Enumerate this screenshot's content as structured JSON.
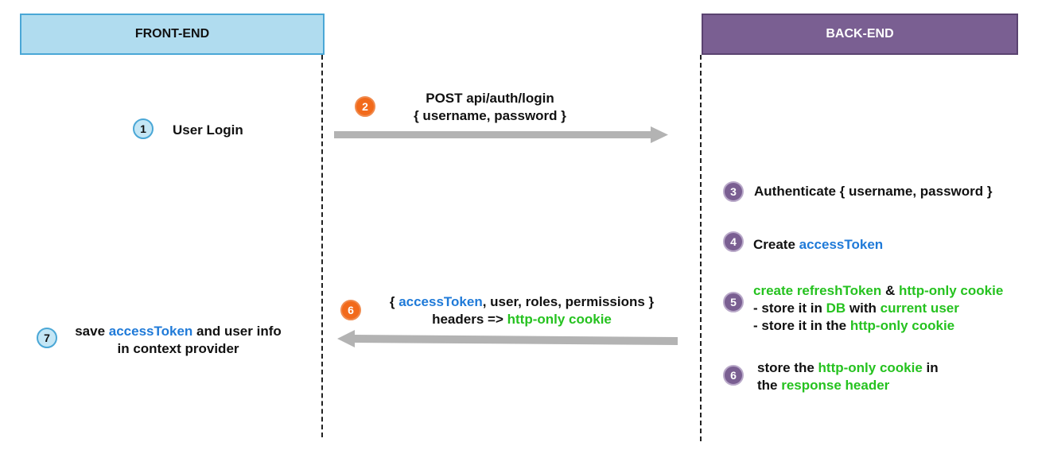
{
  "lanes": {
    "frontend": "FRONT-END",
    "backend": "BACK-END"
  },
  "colors": {
    "frontend_fill": "#b0dcef",
    "backend_fill": "#7a5f92",
    "arrow": "#b3b3b3",
    "highlight_blue": "#1f7ad8",
    "highlight_green": "#25c21f",
    "step2_badge": "#f26a1b"
  },
  "steps": {
    "s1": {
      "num": "1",
      "label": "User Login"
    },
    "s2": {
      "num": "2",
      "method": "POST",
      "path": " api/auth/login",
      "body": "{ username, password }"
    },
    "s3": {
      "num": "3",
      "text": "Authenticate { username, password }"
    },
    "s4": {
      "num": "4",
      "pre": "Create ",
      "token": "accessToken"
    },
    "s5": {
      "num": "5",
      "line1_a": "create refreshToken",
      "line1_b": " & ",
      "line1_c": "http-only cookie",
      "line2_a": " - store it in ",
      "line2_b": "DB",
      "line2_c": " with ",
      "line2_d": "current user",
      "line3_a": " - store it in the ",
      "line3_b": "http-only cookie"
    },
    "s6_back": {
      "num": "6",
      "line1_a": "store the ",
      "line1_b": "http-only cookie",
      "line1_c": " in",
      "line2_a": " the ",
      "line2_b": "response header"
    },
    "s6_resp": {
      "num": "6",
      "line1_a": "{ ",
      "line1_b": "accessToken",
      "line1_c": ", user, roles, permissions }",
      "line2_a": "headers => ",
      "line2_b": "http-only cookie"
    },
    "s7": {
      "num": "7",
      "line1_a": "save ",
      "line1_b": "accessToken",
      "line1_c": " and user info",
      "line2": "in context provider"
    }
  }
}
